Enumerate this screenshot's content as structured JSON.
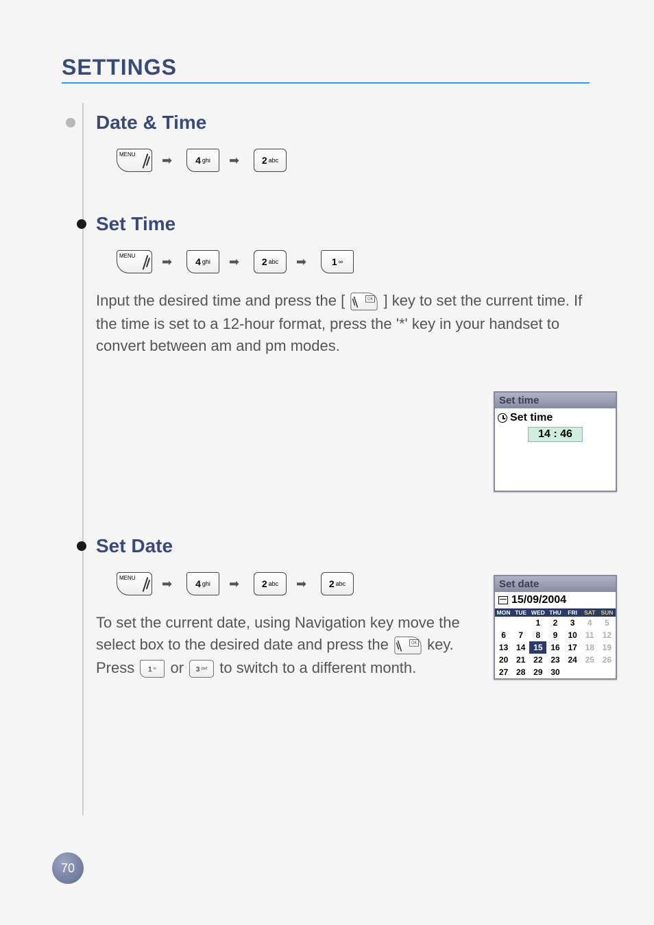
{
  "page_number": "70",
  "header": {
    "title": "SETTINGS"
  },
  "sections": {
    "date_time": {
      "title": "Date & Time"
    },
    "set_time": {
      "title": "Set Time",
      "body": "Input the desired time and press the [",
      "body2": "] key to set the current time. If the time is set to a 12-hour format, press the '*' key in your handset to convert between am and pm modes."
    },
    "set_date": {
      "title": "Set Date",
      "body1": "To set the current date, using Navigation key move the select box to the desired date and press the ",
      "body2": " key. Press ",
      "body3": " or ",
      "body4": " to switch to a different month."
    }
  },
  "keys": {
    "menu_label": "MENU",
    "ok_label": "OK",
    "k1": {
      "num": "1",
      "sub": "∞"
    },
    "k2": {
      "num": "2",
      "sub": "abc"
    },
    "k3": {
      "num": "3",
      "sub": "def"
    },
    "k4": {
      "num": "4",
      "sub": "ghi"
    }
  },
  "set_time_screen": {
    "titlebar": "Set time",
    "heading": "Set time",
    "time_value": "14 : 46"
  },
  "set_date_screen": {
    "titlebar": "Set date",
    "date_heading": "15/09/2004",
    "dow": [
      "MON",
      "TUE",
      "WED",
      "THU",
      "FRI",
      "SAT",
      "SUN"
    ],
    "selected_day": 15,
    "cells": [
      {
        "v": "",
        "cls": ""
      },
      {
        "v": "",
        "cls": ""
      },
      {
        "v": "1",
        "cls": ""
      },
      {
        "v": "2",
        "cls": ""
      },
      {
        "v": "3",
        "cls": ""
      },
      {
        "v": "4",
        "cls": "future"
      },
      {
        "v": "5",
        "cls": "future"
      },
      {
        "v": "6",
        "cls": ""
      },
      {
        "v": "7",
        "cls": ""
      },
      {
        "v": "8",
        "cls": ""
      },
      {
        "v": "9",
        "cls": ""
      },
      {
        "v": "10",
        "cls": ""
      },
      {
        "v": "11",
        "cls": "future"
      },
      {
        "v": "12",
        "cls": "future"
      },
      {
        "v": "13",
        "cls": ""
      },
      {
        "v": "14",
        "cls": ""
      },
      {
        "v": "15",
        "cls": "sel"
      },
      {
        "v": "16",
        "cls": ""
      },
      {
        "v": "17",
        "cls": ""
      },
      {
        "v": "18",
        "cls": "future"
      },
      {
        "v": "19",
        "cls": "future"
      },
      {
        "v": "20",
        "cls": ""
      },
      {
        "v": "21",
        "cls": ""
      },
      {
        "v": "22",
        "cls": ""
      },
      {
        "v": "23",
        "cls": ""
      },
      {
        "v": "24",
        "cls": ""
      },
      {
        "v": "25",
        "cls": "future"
      },
      {
        "v": "26",
        "cls": "future"
      },
      {
        "v": "27",
        "cls": ""
      },
      {
        "v": "28",
        "cls": ""
      },
      {
        "v": "29",
        "cls": ""
      },
      {
        "v": "30",
        "cls": ""
      },
      {
        "v": "",
        "cls": ""
      },
      {
        "v": "",
        "cls": ""
      },
      {
        "v": "",
        "cls": ""
      }
    ]
  }
}
